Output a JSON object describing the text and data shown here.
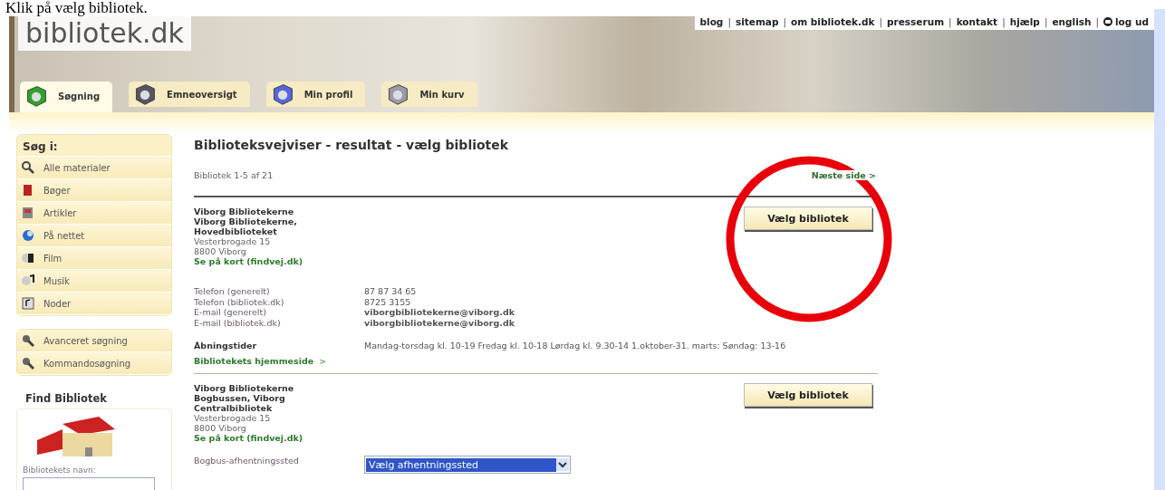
{
  "caption": "Klik på vælg bibliotek.",
  "header": {
    "logo": "bibliotek.dk",
    "separator": "|",
    "top_links": [
      {
        "label": "blog"
      },
      {
        "label": "sitemap"
      },
      {
        "label": "om bibliotek.dk"
      },
      {
        "label": "presserum"
      },
      {
        "label": "kontakt"
      },
      {
        "label": "hjælp"
      },
      {
        "label": "english"
      },
      {
        "label": "log ud",
        "kind": "logout"
      }
    ],
    "tabs": [
      {
        "label": "Søgning",
        "selected": true
      },
      {
        "label": "Emneoversigt",
        "selected": false
      },
      {
        "label": "Min profil",
        "selected": false
      },
      {
        "label": "Min kurv",
        "selected": false
      }
    ]
  },
  "sidebar": {
    "search_title": "Søg i:",
    "search_items": [
      {
        "label": "Alle materialer"
      },
      {
        "label": "Bøger"
      },
      {
        "label": "Artikler"
      },
      {
        "label": "På nettet"
      },
      {
        "label": "Film"
      },
      {
        "label": "Musik"
      },
      {
        "label": "Noder"
      }
    ],
    "tools": [
      {
        "label": "Avanceret søgning"
      },
      {
        "label": "Kommandosøgning"
      }
    ],
    "find_title": "Find Bibliotek",
    "name_label": "Bibliotekets navn:"
  },
  "main": {
    "title": "Biblioteksvejviser - resultat - vælg bibliotek",
    "count": "Bibliotek 1-5 af 21",
    "next_link": "Næste side >",
    "results": [
      {
        "name_lines": [
          "Viborg Bibliotekerne",
          "Viborg Bibliotekerne,",
          "Hovedbiblioteket"
        ],
        "address": [
          "Vesterbrogade 15",
          "8800 Viborg"
        ],
        "map_link": "Se på kort (findvej.dk)",
        "button": "Vælg bibliotek",
        "details": [
          {
            "label": "Telefon (generelt)",
            "value": "87 87 34 65",
            "kind": "text"
          },
          {
            "label": "Telefon (bibliotek.dk)",
            "value": "8725 3155",
            "kind": "text"
          },
          {
            "label": "E-mail (generelt)",
            "value": "viborgbibliotekerne@viborg.dk",
            "kind": "link"
          },
          {
            "label": "E-mail (bibliotek.dk)",
            "value": "viborgbibliotekerne@viborg.dk",
            "kind": "link"
          }
        ],
        "opening_label": "Åbningstider",
        "opening_value": "Mandag-torsdag kl. 10-19 Fredag kl. 10-18 Lørdag kl. 9.30-14 1.oktober-31. marts: Søndag: 13-16",
        "homepage_link": "Bibliotekets hjemmeside",
        "homepage_arrow": ">"
      },
      {
        "name_lines": [
          "Viborg Bibliotekerne",
          "Bogbussen, Viborg",
          "Centralbibliotek"
        ],
        "address": [
          "Vesterbrogade 15",
          "8800 Viborg"
        ],
        "map_link": "Se på kort (findvej.dk)",
        "button": "Vælg bibliotek",
        "pickup": {
          "label": "Bogbus-afhentningssted",
          "value": "Vælg afhentningssted"
        }
      }
    ]
  },
  "annotation": {
    "kind": "circle"
  }
}
